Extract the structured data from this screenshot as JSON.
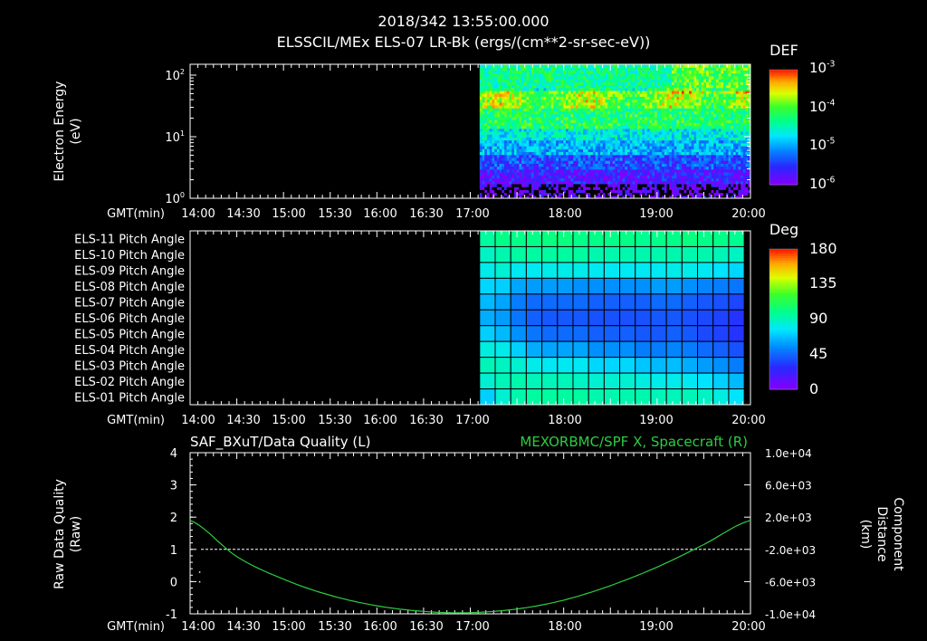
{
  "header": {
    "timestamp": "2018/342 13:55:00.000",
    "product": "ELSSCIL/MEx ELS-07 LR-Bk  (ergs/(cm**2-sr-sec-eV))"
  },
  "time_axis": {
    "label": "GMT(min)",
    "ticks": [
      "14:00",
      "14:30",
      "15:00",
      "15:30",
      "16:00",
      "16:30",
      "17:00",
      "18:00",
      "19:00",
      "20:00"
    ]
  },
  "colors": {
    "axis": "#ffffff",
    "background": "#000000",
    "series_right": "#2ecc40",
    "series_left": "#ffffff"
  },
  "chart_data": [
    {
      "type": "heatmap",
      "ylabel": "Electron Energy (eV)",
      "ylabel_lines": [
        "Electron Energy",
        "(eV)"
      ],
      "yscale": "log",
      "ylim": [
        1,
        150
      ],
      "yticks": [
        {
          "base": "10",
          "exp": "2"
        },
        {
          "base": "10",
          "exp": "1"
        },
        {
          "base": "10",
          "exp": "0"
        }
      ],
      "data_start": "17:06",
      "data_end": "20:00",
      "empty_before": "17:06",
      "colorbar": {
        "title": "DEF",
        "scale": "log",
        "labels": [
          {
            "base": "10",
            "exp": "-3"
          },
          {
            "base": "10",
            "exp": "-4"
          },
          {
            "base": "10",
            "exp": "-5"
          },
          {
            "base": "10",
            "exp": "-6"
          }
        ],
        "colors": [
          "#ff2000",
          "#ffb000",
          "#d8ff00",
          "#20ff40",
          "#00ffd0",
          "#00a0ff",
          "#2020ff",
          "#8000ff"
        ]
      },
      "bands_log10_eV": [
        {
          "from": 1.75,
          "to": 2.2,
          "level": 0.55
        },
        {
          "from": 1.45,
          "to": 1.75,
          "level": 0.72
        },
        {
          "from": 1.15,
          "to": 1.45,
          "level": 0.6
        },
        {
          "from": 0.95,
          "to": 1.15,
          "level": 0.45
        },
        {
          "from": 0.7,
          "to": 0.95,
          "level": 0.35
        },
        {
          "from": 0.45,
          "to": 0.7,
          "level": 0.2
        },
        {
          "from": 0.25,
          "to": 0.45,
          "level": 0.1
        },
        {
          "from": 0.0,
          "to": 0.25,
          "level": 0.02
        }
      ]
    },
    {
      "type": "heatmap",
      "rows": [
        "ELS-11 Pitch Angle",
        "ELS-10 Pitch Angle",
        "ELS-09 Pitch Angle",
        "ELS-08 Pitch Angle",
        "ELS-07 Pitch Angle",
        "ELS-06 Pitch Angle",
        "ELS-05 Pitch Angle",
        "ELS-04 Pitch Angle",
        "ELS-03 Pitch Angle",
        "ELS-02 Pitch Angle",
        "ELS-01 Pitch Angle"
      ],
      "data_start": "17:06",
      "data_end": "20:00",
      "columns": 17,
      "colorbar": {
        "title": "Deg",
        "labels": [
          "180",
          "135",
          "90",
          "45",
          "0"
        ],
        "range": [
          0,
          180
        ]
      },
      "pitch_angle_deg_by_row": [
        [
          95,
          100,
          100,
          100,
          102,
          102,
          100,
          100,
          100,
          100,
          98,
          100,
          100,
          102,
          100,
          100,
          98
        ],
        [
          88,
          92,
          95,
          95,
          95,
          95,
          95,
          92,
          92,
          92,
          92,
          92,
          92,
          92,
          92,
          90,
          88
        ],
        [
          80,
          85,
          78,
          78,
          80,
          80,
          80,
          78,
          78,
          78,
          78,
          78,
          80,
          80,
          78,
          75,
          72
        ],
        [
          72,
          70,
          60,
          58,
          58,
          58,
          55,
          55,
          55,
          55,
          55,
          58,
          58,
          55,
          52,
          50,
          48
        ],
        [
          65,
          60,
          50,
          45,
          45,
          45,
          45,
          42,
          42,
          42,
          42,
          45,
          45,
          42,
          40,
          38,
          35
        ],
        [
          62,
          58,
          48,
          42,
          40,
          40,
          40,
          38,
          38,
          38,
          38,
          40,
          40,
          38,
          36,
          34,
          30
        ],
        [
          70,
          65,
          55,
          48,
          45,
          45,
          45,
          42,
          42,
          42,
          40,
          40,
          42,
          40,
          36,
          34,
          30
        ],
        [
          82,
          80,
          70,
          62,
          60,
          60,
          60,
          55,
          55,
          55,
          50,
          50,
          52,
          50,
          45,
          42,
          38
        ],
        [
          90,
          88,
          85,
          80,
          78,
          78,
          78,
          72,
          72,
          72,
          68,
          65,
          66,
          62,
          58,
          55,
          50
        ],
        [
          85,
          90,
          92,
          90,
          90,
          90,
          88,
          85,
          85,
          85,
          82,
          80,
          80,
          78,
          75,
          70,
          65
        ],
        [
          70,
          85,
          92,
          95,
          95,
          95,
          95,
          92,
          92,
          92,
          92,
          90,
          90,
          90,
          88,
          82,
          75
        ]
      ]
    },
    {
      "type": "line",
      "title_left": "SAF_BXuT/Data Quality (L)",
      "title_right": "MEXORBMC/SPF X, Spacecraft (R)",
      "ylabel_left_lines": [
        "Raw Data Quality",
        "(Raw)"
      ],
      "ylabel_right_lines": [
        "Component",
        "Distance",
        "(km)"
      ],
      "ylim_left": [
        -1,
        4
      ],
      "yticks_left": [
        "4",
        "3",
        "2",
        "1",
        "0",
        "-1"
      ],
      "ylim_right": [
        -10000,
        10000
      ],
      "yticks_right": [
        "1.0e+04",
        "6.0e+03",
        "2.0e+03",
        "-2.0e+03",
        "-6.0e+03",
        "-1.0e+04"
      ],
      "series": [
        {
          "axis": "left",
          "x": [
            "17:06",
            "17:30",
            "18:00",
            "18:30",
            "19:00",
            "19:30",
            "20:00"
          ],
          "values": [
            1,
            1,
            1,
            1,
            1,
            1,
            1
          ]
        },
        {
          "axis": "right",
          "x": [
            "14:00",
            "14:30",
            "15:00",
            "15:30",
            "16:00",
            "16:30",
            "17:00",
            "17:30",
            "18:00",
            "18:30",
            "19:00",
            "19:30",
            "20:00"
          ],
          "values": [
            1600,
            -2900,
            -5700,
            -7700,
            -9000,
            -9700,
            -9850,
            -9400,
            -8300,
            -6500,
            -4200,
            -1400,
            1600
          ]
        }
      ],
      "left_outliers": [
        {
          "x": "14:06",
          "y": 0.3
        },
        {
          "x": "14:06",
          "y": 0.0
        }
      ]
    }
  ]
}
